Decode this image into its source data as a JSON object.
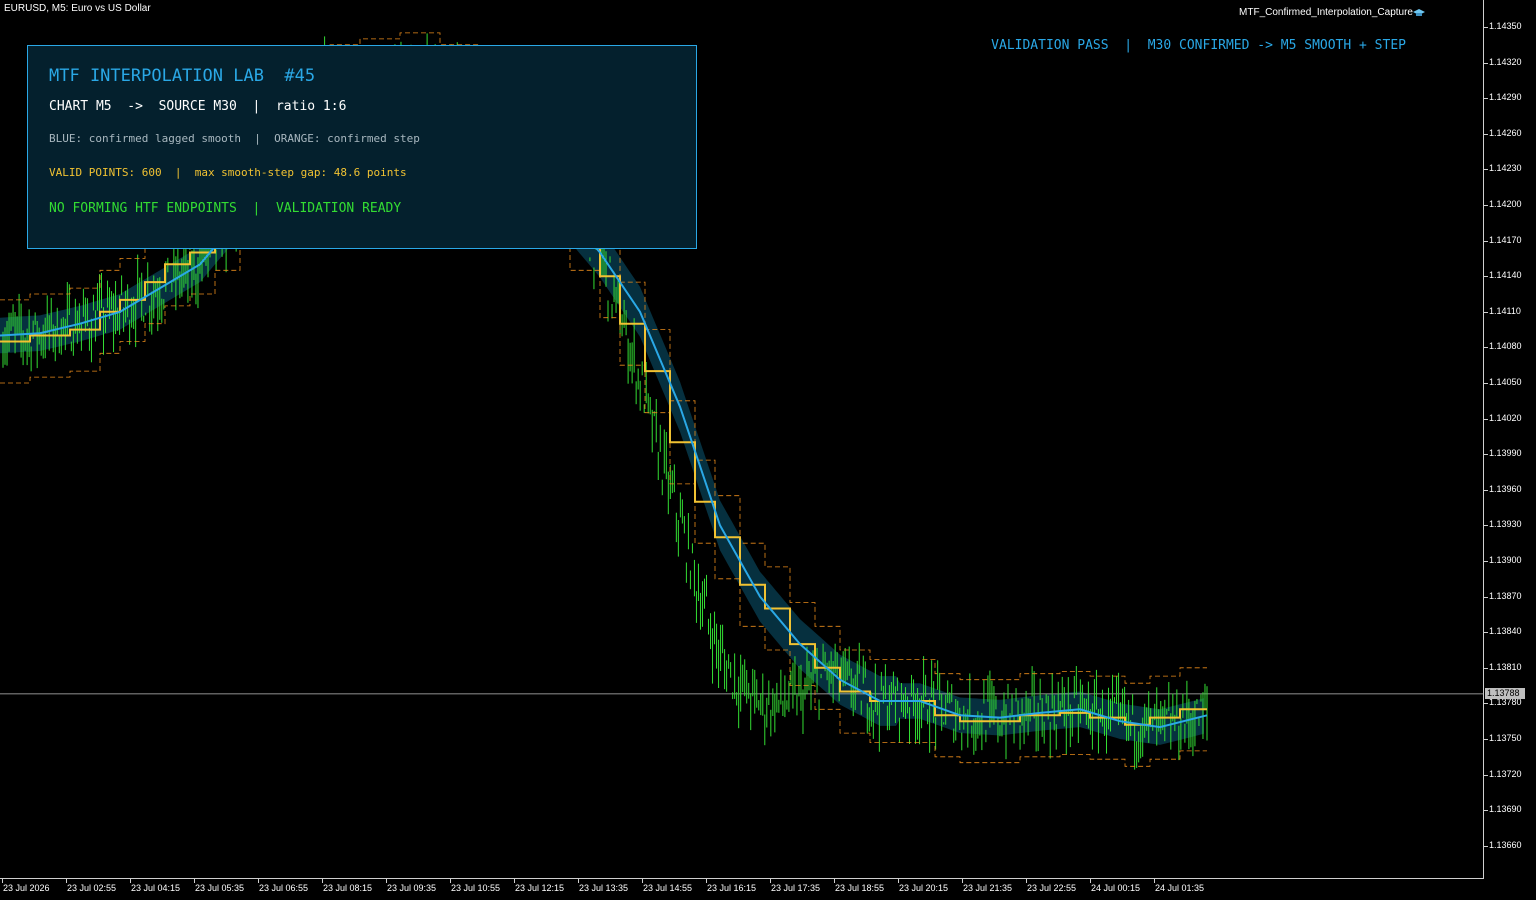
{
  "window": {
    "symbol_label": "EURUSD, M5:  Euro vs US Dollar",
    "ea_label": "MTF_Confirmed_Interpolation_Capture",
    "ea_icon": "graduation-cap-icon"
  },
  "status_banner": "VALIDATION PASS  |  M30 CONFIRMED -> M5 SMOOTH + STEP",
  "panel": {
    "title": "MTF INTERPOLATION LAB  #45",
    "line1": "CHART M5  ->  SOURCE M30  |  ratio 1:6",
    "line2": "BLUE: confirmed lagged smooth  |  ORANGE: confirmed step",
    "line3": "VALID POINTS: 600  |  max smooth-step gap: 48.6 points",
    "line4": "NO FORMING HTF ENDPOINTS  |  VALIDATION READY"
  },
  "colors": {
    "candles": "#33dd33",
    "smooth": "#2aa8e6",
    "band": "#06303f",
    "step": "#f1c232",
    "step_envelope": "#e88a1a",
    "current_line": "#bfbfbf"
  },
  "price_axis": {
    "ticks": [
      "1.14350",
      "1.14320",
      "1.14290",
      "1.14260",
      "1.14230",
      "1.14200",
      "1.14170",
      "1.14140",
      "1.14110",
      "1.14080",
      "1.14050",
      "1.14020",
      "1.13990",
      "1.13960",
      "1.13930",
      "1.13900",
      "1.13870",
      "1.13840",
      "1.13810",
      "1.13780",
      "1.13750",
      "1.13720",
      "1.13690",
      "1.13660"
    ],
    "current": "1.13788"
  },
  "time_axis": {
    "ticks": [
      "23 Jul 2026",
      "23 Jul 02:55",
      "23 Jul 04:15",
      "23 Jul 05:35",
      "23 Jul 06:55",
      "23 Jul 08:15",
      "23 Jul 09:35",
      "23 Jul 10:55",
      "23 Jul 12:15",
      "23 Jul 13:35",
      "23 Jul 14:55",
      "23 Jul 16:15",
      "23 Jul 17:35",
      "23 Jul 18:55",
      "23 Jul 20:15",
      "23 Jul 21:35",
      "23 Jul 22:55",
      "24 Jul 00:15",
      "24 Jul 01:35"
    ]
  },
  "chart_data": {
    "type": "line",
    "ylim": [
      1.13645,
      1.14365
    ],
    "current_price": 1.13788,
    "smooth_points": [
      [
        0,
        1.1409
      ],
      [
        40,
        1.14092
      ],
      [
        80,
        1.141
      ],
      [
        120,
        1.1411
      ],
      [
        160,
        1.1413
      ],
      [
        200,
        1.1415
      ],
      [
        240,
        1.1419
      ],
      [
        280,
        1.1424
      ],
      [
        340,
        1.1429
      ],
      [
        420,
        1.1431
      ],
      [
        480,
        1.143
      ],
      [
        520,
        1.1425
      ],
      [
        560,
        1.142
      ],
      [
        600,
        1.1416
      ],
      [
        640,
        1.1411
      ],
      [
        680,
        1.1403
      ],
      [
        720,
        1.1393
      ],
      [
        760,
        1.1387
      ],
      [
        800,
        1.1383
      ],
      [
        840,
        1.138
      ],
      [
        880,
        1.13782
      ],
      [
        920,
        1.13782
      ],
      [
        960,
        1.1377
      ],
      [
        1000,
        1.13768
      ],
      [
        1040,
        1.13772
      ],
      [
        1080,
        1.13775
      ],
      [
        1120,
        1.13765
      ],
      [
        1160,
        1.1376
      ],
      [
        1207,
        1.1377
      ]
    ],
    "band_half_width": 0.00015,
    "step_points": [
      [
        0,
        1.14085
      ],
      [
        30,
        1.1409
      ],
      [
        70,
        1.14095
      ],
      [
        100,
        1.1411
      ],
      [
        120,
        1.1412
      ],
      [
        145,
        1.14135
      ],
      [
        165,
        1.1415
      ],
      [
        190,
        1.1416
      ],
      [
        215,
        1.1418
      ],
      [
        240,
        1.1422
      ],
      [
        270,
        1.1426
      ],
      [
        300,
        1.1429
      ],
      [
        330,
        1.143
      ],
      [
        360,
        1.14305
      ],
      [
        400,
        1.1431
      ],
      [
        440,
        1.143
      ],
      [
        480,
        1.1428
      ],
      [
        510,
        1.1425
      ],
      [
        540,
        1.1423
      ],
      [
        570,
        1.1418
      ],
      [
        600,
        1.1414
      ],
      [
        620,
        1.141
      ],
      [
        645,
        1.1406
      ],
      [
        670,
        1.14
      ],
      [
        695,
        1.1395
      ],
      [
        715,
        1.1392
      ],
      [
        740,
        1.1388
      ],
      [
        765,
        1.1386
      ],
      [
        790,
        1.1383
      ],
      [
        815,
        1.1381
      ],
      [
        840,
        1.1379
      ],
      [
        870,
        1.13782
      ],
      [
        910,
        1.13782
      ],
      [
        935,
        1.1377
      ],
      [
        960,
        1.13765
      ],
      [
        990,
        1.13765
      ],
      [
        1020,
        1.1377
      ],
      [
        1060,
        1.13772
      ],
      [
        1090,
        1.13768
      ],
      [
        1125,
        1.13762
      ],
      [
        1150,
        1.13768
      ],
      [
        1180,
        1.13775
      ],
      [
        1207,
        1.13775
      ]
    ],
    "step_envelope_offset": 0.00035,
    "candle_count": 600
  }
}
